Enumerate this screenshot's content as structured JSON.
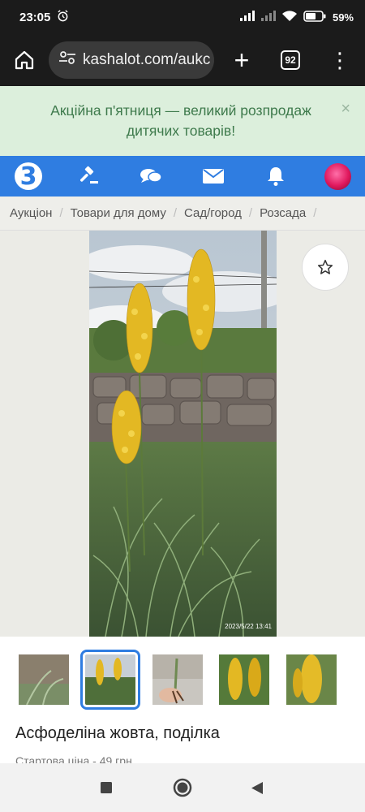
{
  "status_bar": {
    "time": "23:05",
    "battery": "59%"
  },
  "browser": {
    "url": "kashalot.com/aukc",
    "tab_count": "92"
  },
  "promo_banner": {
    "text": "Акційна п'ятниця — великий розпродаж дитячих товарів!",
    "close": "×"
  },
  "navbar": {
    "logo": "3"
  },
  "breadcrumb": [
    "Аукціон",
    "Товари для дому",
    "Сад/город",
    "Розсада"
  ],
  "photo": {
    "timestamp": "2023/5/22 13:41"
  },
  "listing": {
    "title": "Асфоделіна жовта, поділка",
    "price_line": "Стартова ціна - 49 грн"
  },
  "colors": {
    "brand_blue": "#2f7de1",
    "promo_bg": "#dcefdc",
    "promo_text": "#3e7a4c"
  }
}
